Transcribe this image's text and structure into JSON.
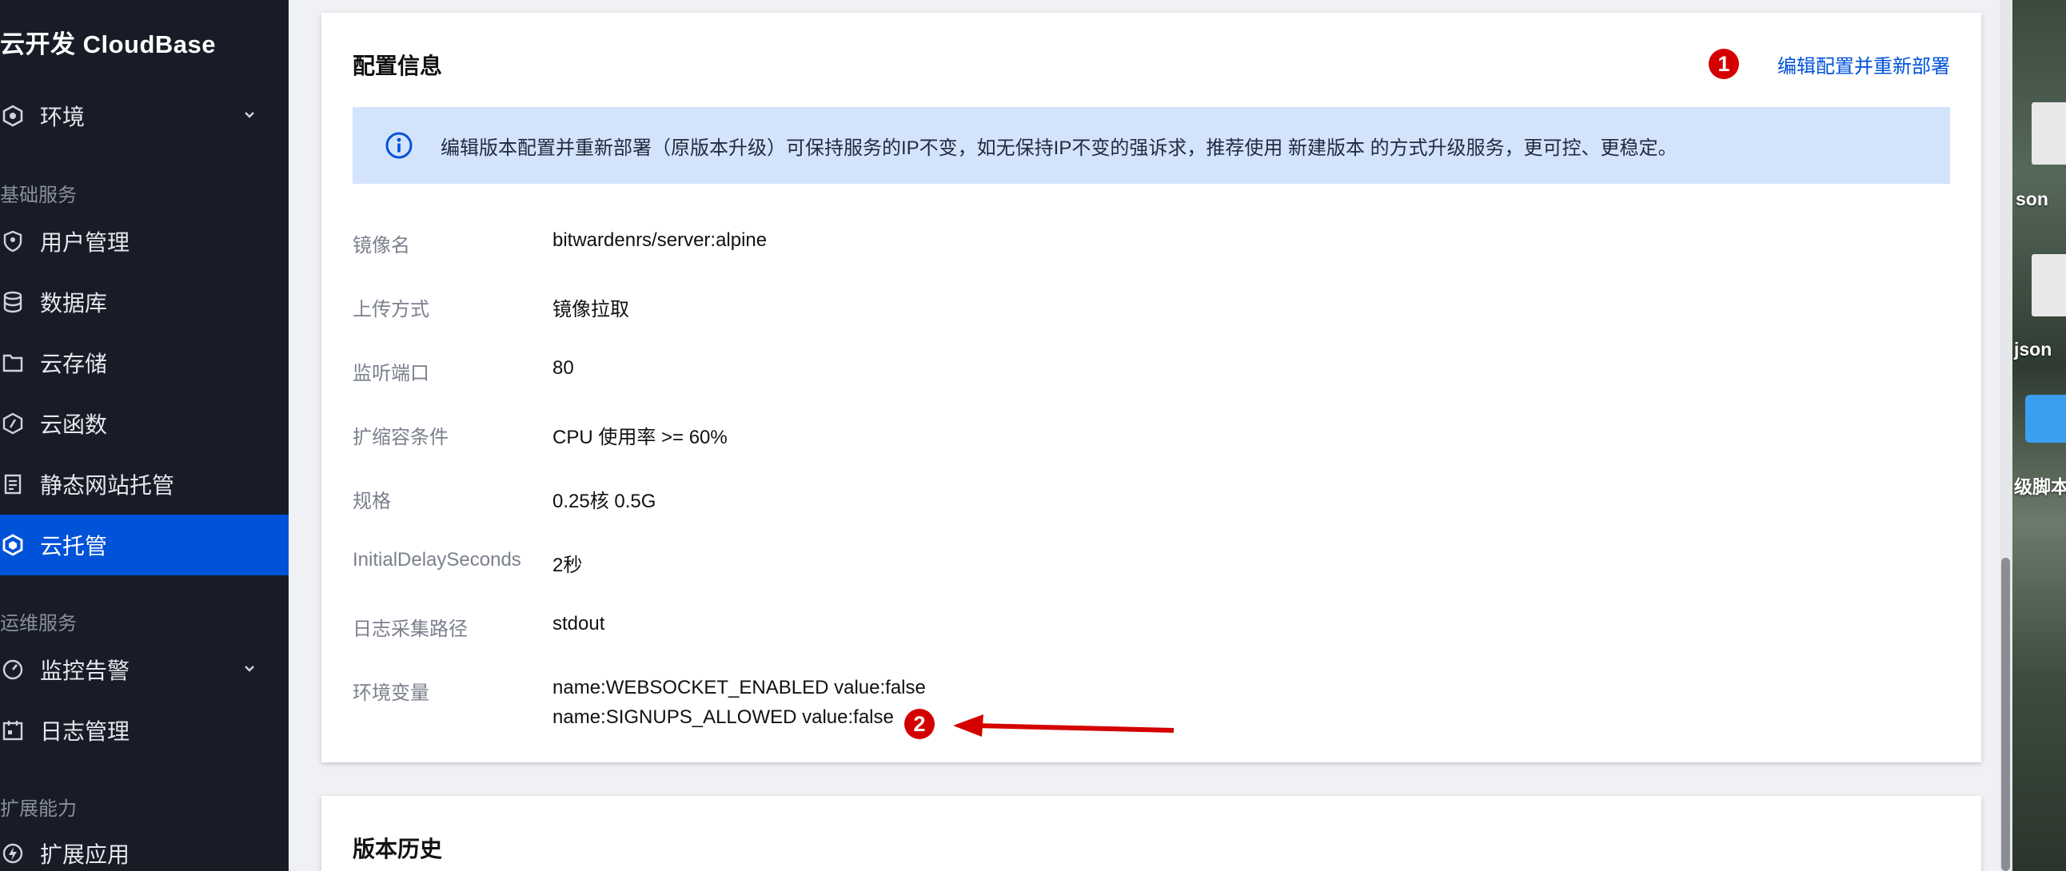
{
  "sidebar": {
    "brand": "云开发 CloudBase",
    "env_label": "环境",
    "section_basic": "基础服务",
    "items_basic": [
      {
        "label": "用户管理",
        "icon": "user-shield-icon"
      },
      {
        "label": "数据库",
        "icon": "database-icon"
      },
      {
        "label": "云存储",
        "icon": "folder-icon"
      },
      {
        "label": "云函数",
        "icon": "function-icon"
      },
      {
        "label": "静态网站托管",
        "icon": "document-icon"
      },
      {
        "label": "云托管",
        "icon": "hexagon-icon",
        "active": true
      }
    ],
    "section_ops": "运维服务",
    "items_ops": [
      {
        "label": "监控告警",
        "icon": "gauge-icon"
      },
      {
        "label": "日志管理",
        "icon": "calendar-log-icon"
      }
    ],
    "section_ext": "扩展能力",
    "items_ext": [
      {
        "label": "扩展应用",
        "icon": "lightning-icon"
      }
    ]
  },
  "config": {
    "title": "配置信息",
    "edit_link": "编辑配置并重新部署",
    "notice": "编辑版本配置并重新部署（原版本升级）可保持服务的IP不变，如无保持IP不变的强诉求，推荐使用 新建版本 的方式升级服务，更可控、更稳定。",
    "rows": [
      {
        "label": "镜像名",
        "value": "bitwardenrs/server:alpine"
      },
      {
        "label": "上传方式",
        "value": "镜像拉取"
      },
      {
        "label": "监听端口",
        "value": "80"
      },
      {
        "label": "扩缩容条件",
        "value": "CPU 使用率 >= 60%"
      },
      {
        "label": "规格",
        "value": "0.25核 0.5G"
      },
      {
        "label": "InitialDelaySeconds",
        "value": "2秒"
      },
      {
        "label": "日志采集路径",
        "value": "stdout"
      }
    ],
    "env_label": "环境变量",
    "env_values": [
      "name:WEBSOCKET_ENABLED value:false",
      "name:SIGNUPS_ALLOWED value:false"
    ]
  },
  "annotations": {
    "badge_1": "1",
    "badge_2": "2",
    "color": "#d40000"
  },
  "history": {
    "title": "版本历史"
  },
  "desktop": {
    "labels": [
      "son",
      "json",
      "级脚本"
    ]
  },
  "colors": {
    "sidebar_bg": "#181c27",
    "active_bg": "#0052d9",
    "link": "#0052d9",
    "notice_bg": "#d4e3fc"
  }
}
